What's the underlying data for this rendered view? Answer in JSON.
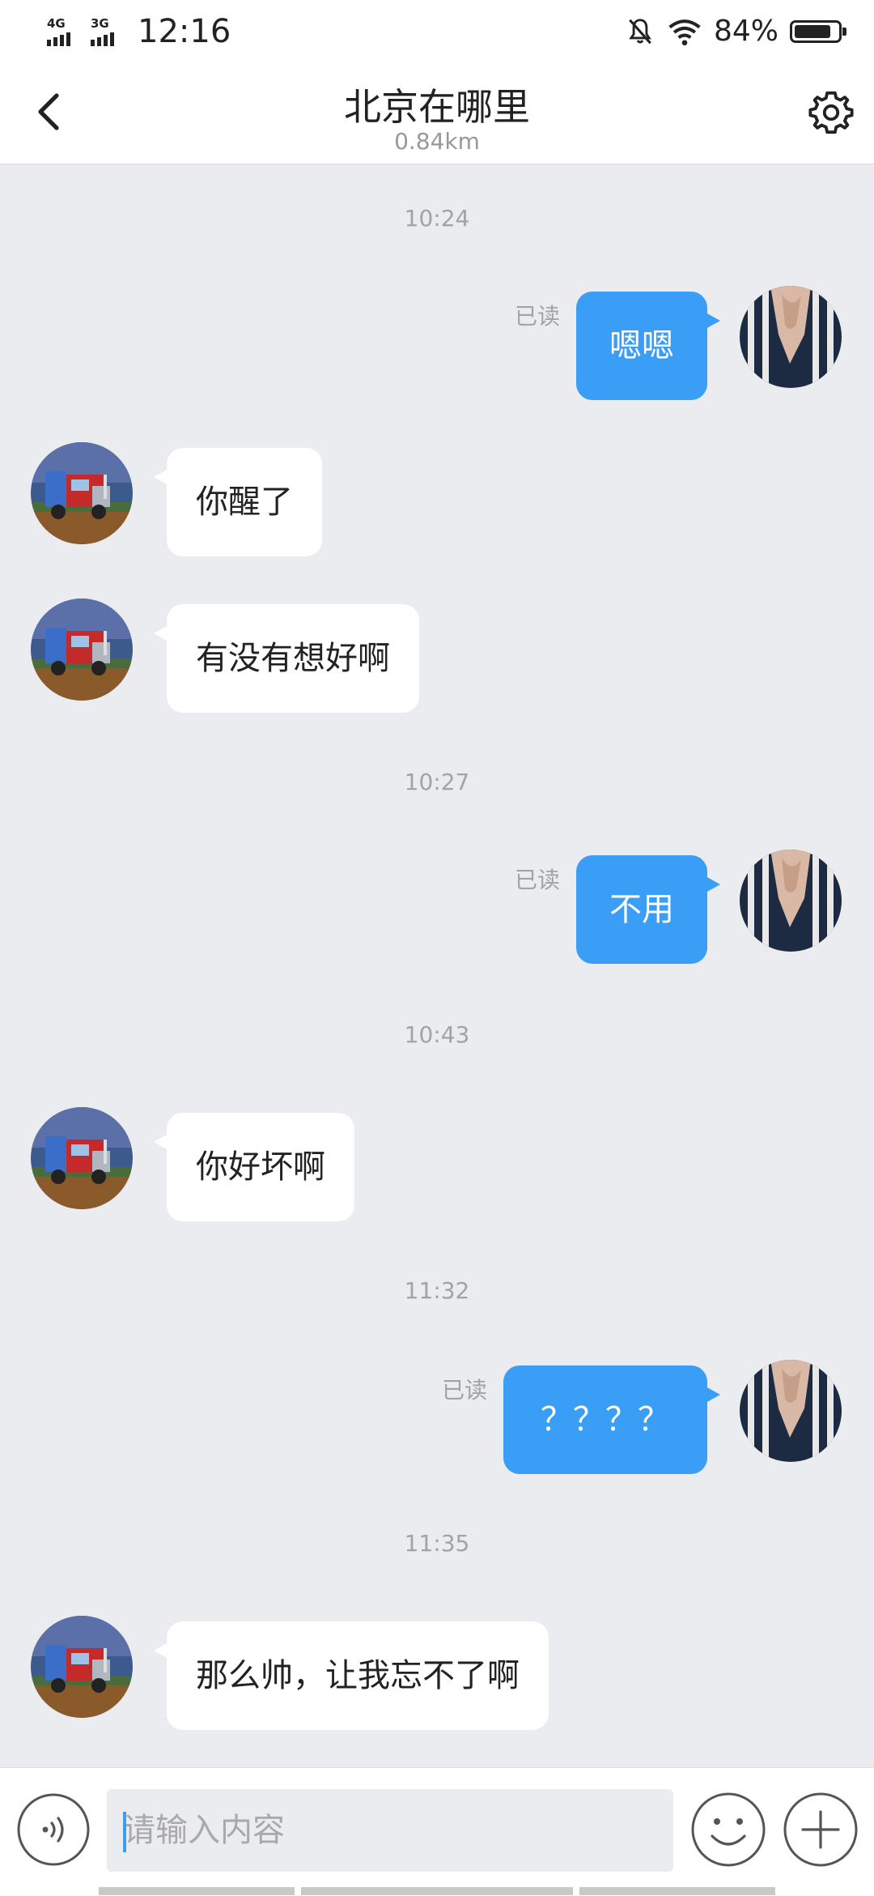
{
  "status_bar": {
    "network_1": "4G",
    "network_2": "3G",
    "time": "12:16",
    "battery": "84%",
    "battery_level": 0.84
  },
  "header": {
    "title": "北京在哪里",
    "subtitle": "0.84km"
  },
  "chat": {
    "timestamps": [
      "10:24",
      "10:27",
      "10:43",
      "11:32",
      "11:35"
    ],
    "read_label": "已读",
    "messages": [
      {
        "direction": "out",
        "text": "嗯嗯",
        "read": "已读"
      },
      {
        "direction": "in",
        "text": "你醒了"
      },
      {
        "direction": "in",
        "text": "有没有想好啊"
      },
      {
        "direction": "out",
        "text": "不用",
        "read": "已读"
      },
      {
        "direction": "in",
        "text": "你好坏啊"
      },
      {
        "direction": "out",
        "text": "？？？？",
        "read": "已读"
      },
      {
        "direction": "in",
        "text": "那么帅，让我忘不了啊"
      }
    ]
  },
  "input_bar": {
    "placeholder": "请输入内容"
  },
  "icons": {
    "back": "chevron-left-icon",
    "settings": "gear-icon",
    "voice": "voice-icon",
    "emoji": "smiley-icon",
    "more": "plus-icon",
    "silent": "bell-off-icon",
    "wifi": "wifi-icon"
  },
  "colors": {
    "accent": "#3a9df6",
    "chat_background": "#ebecef",
    "incoming_bubble": "#ffffff"
  }
}
